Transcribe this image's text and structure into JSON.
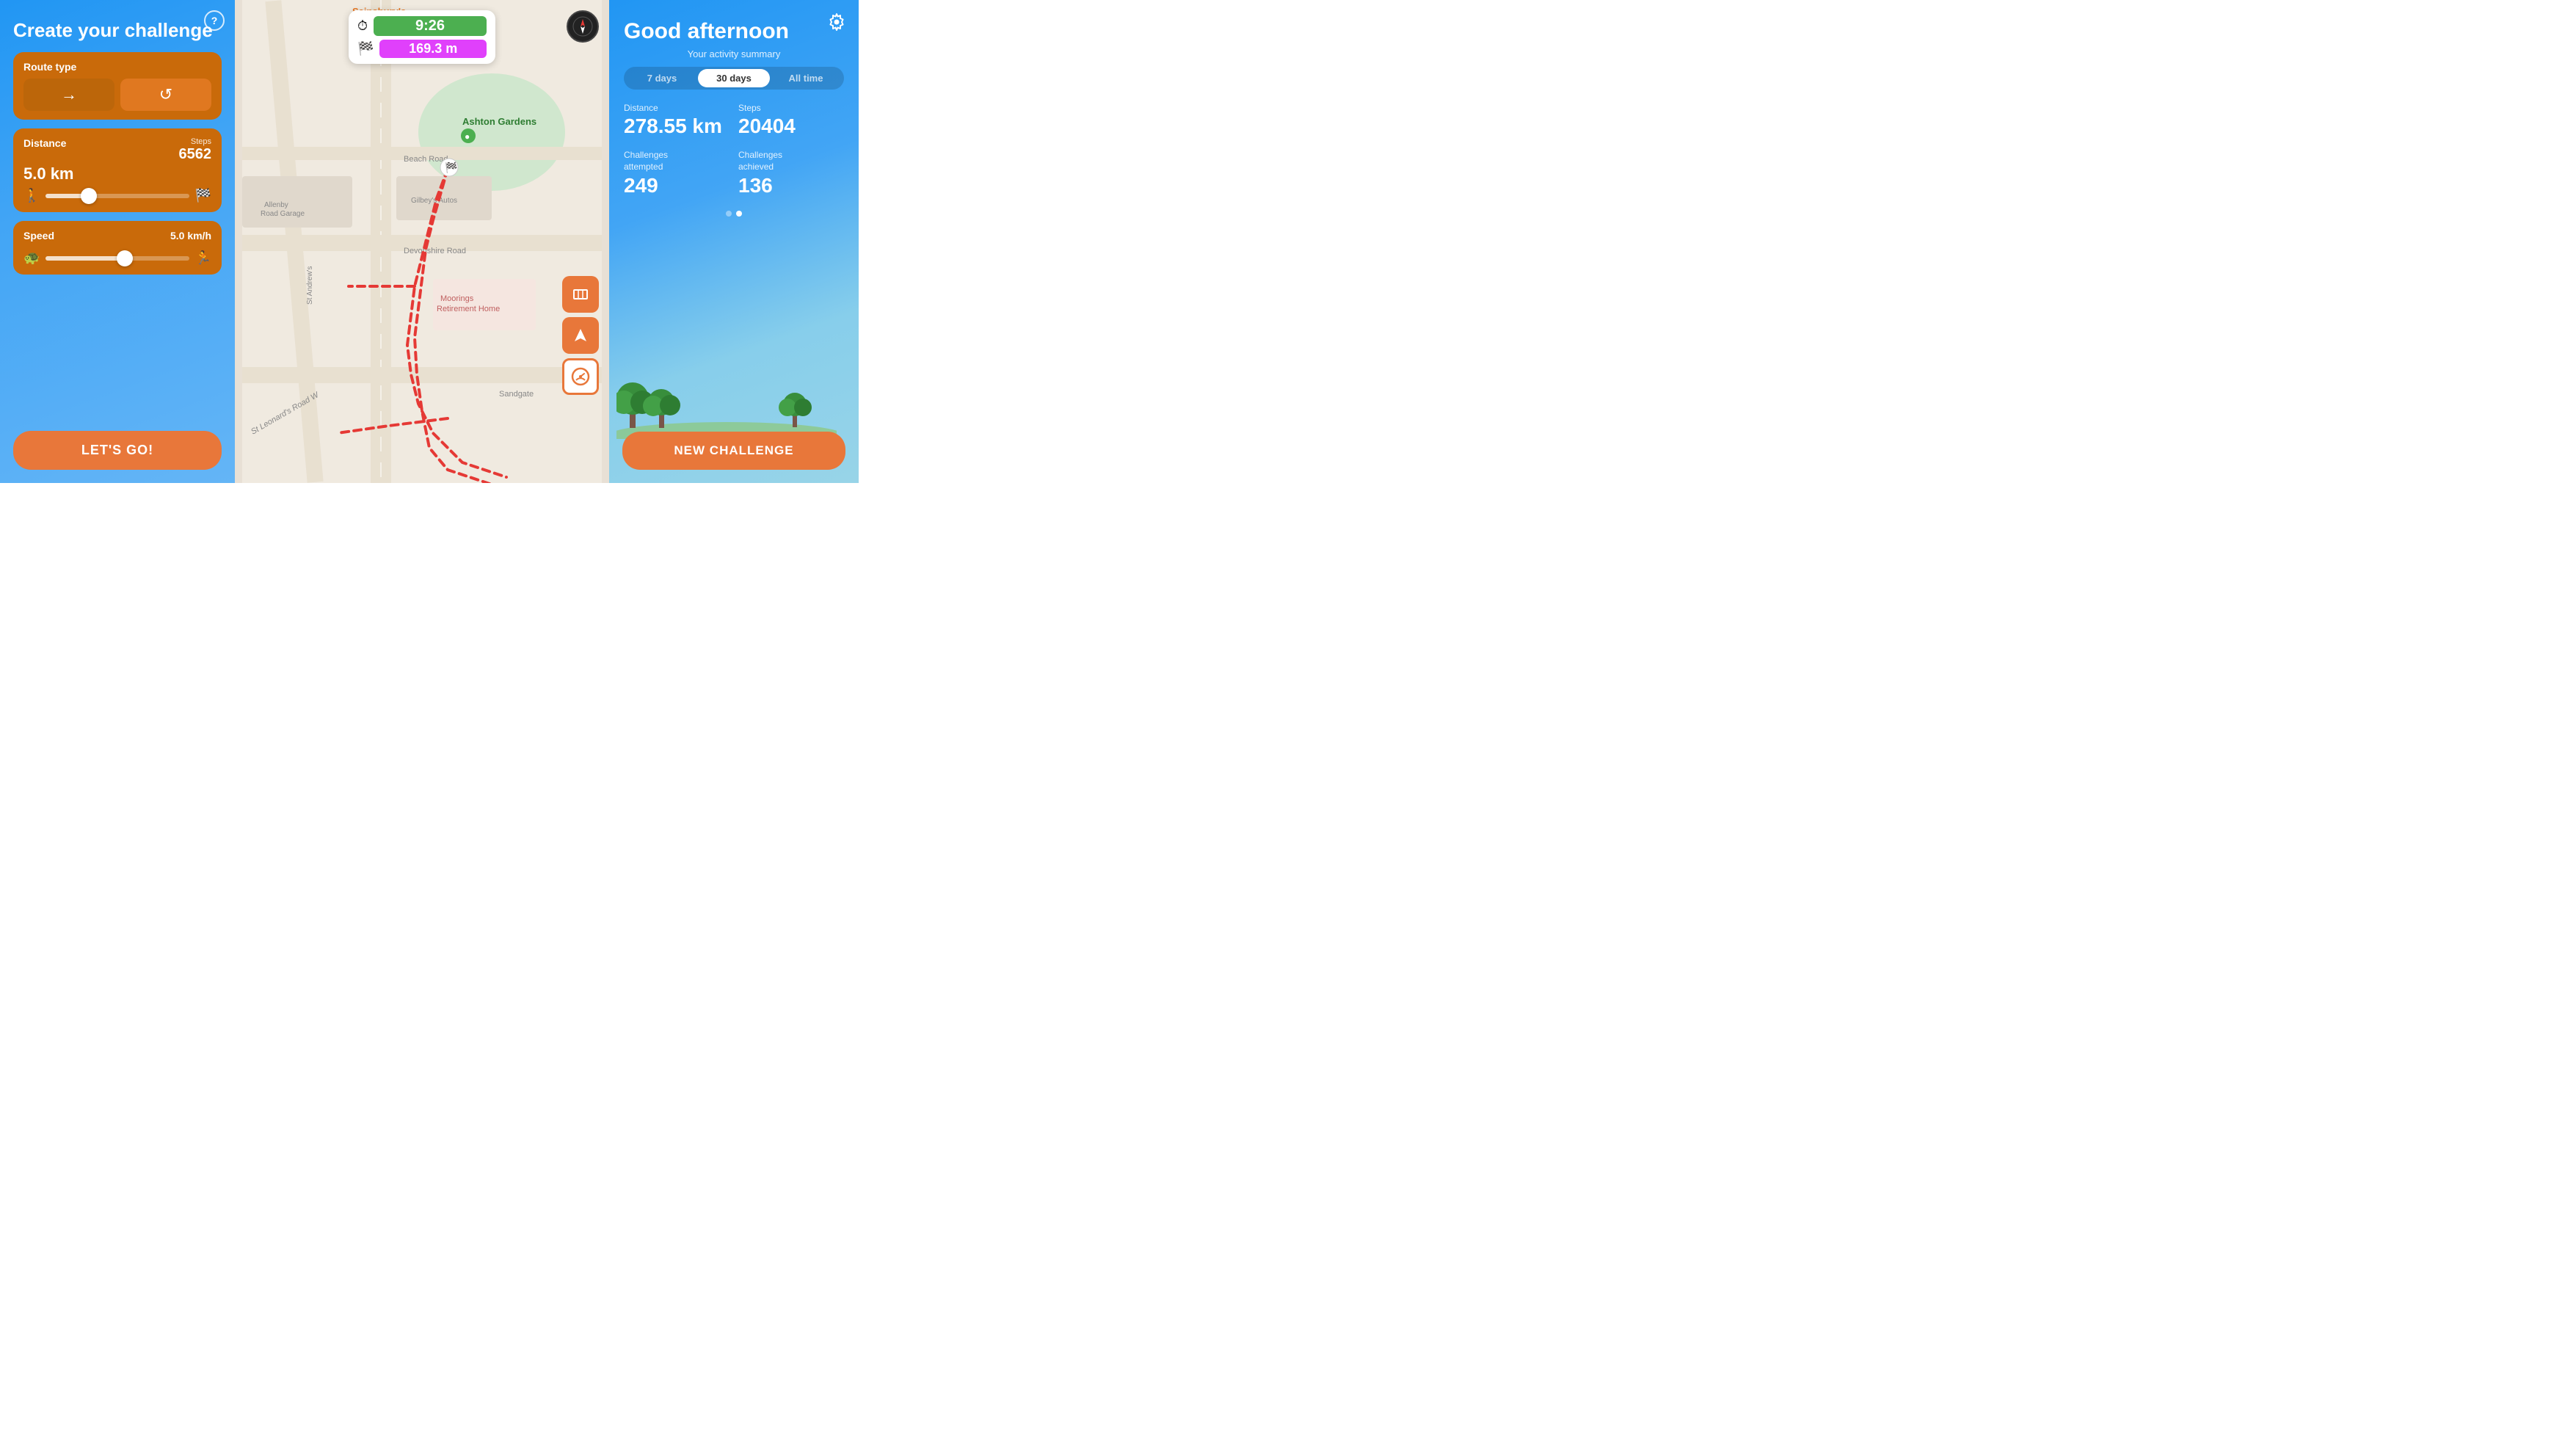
{
  "left": {
    "title": "Create your challenge",
    "help_label": "?",
    "route_type_label": "Route type",
    "route_btn_one_way": "→",
    "route_btn_loop": "↺",
    "distance_label": "Distance",
    "distance_value": "5.0 km",
    "steps_label": "Steps",
    "steps_value": "6562",
    "distance_slider_pct": 30,
    "speed_label": "Speed",
    "speed_value": "5.0 km/h",
    "speed_slider_pct": 55,
    "lets_go_label": "LET'S GO!"
  },
  "map": {
    "time_value": "9:26",
    "distance_value": "169.3 m"
  },
  "right": {
    "greeting": "Good afternoon",
    "activity_subtitle": "Your activity summary",
    "tabs": [
      {
        "label": "7 days",
        "active": false
      },
      {
        "label": "30 days",
        "active": true
      },
      {
        "label": "All time",
        "active": false
      }
    ],
    "distance_label": "Distance",
    "distance_value": "278.55 km",
    "steps_label": "Steps",
    "steps_value": "20404",
    "challenges_attempted_label": "Challenges attempted",
    "challenges_attempted_value": "249",
    "challenges_achieved_label": "Challenges achieved",
    "challenges_achieved_value": "136",
    "new_challenge_label": "NEW CHALLENGE",
    "settings_icon": "⚙"
  },
  "colors": {
    "orange": "#E8773A",
    "dark_orange": "#C96A0A",
    "blue_light": "#64B5F6",
    "blue_dark": "#2196F3",
    "green": "#4CAF50",
    "purple": "#E040FB",
    "white": "#FFFFFF"
  }
}
